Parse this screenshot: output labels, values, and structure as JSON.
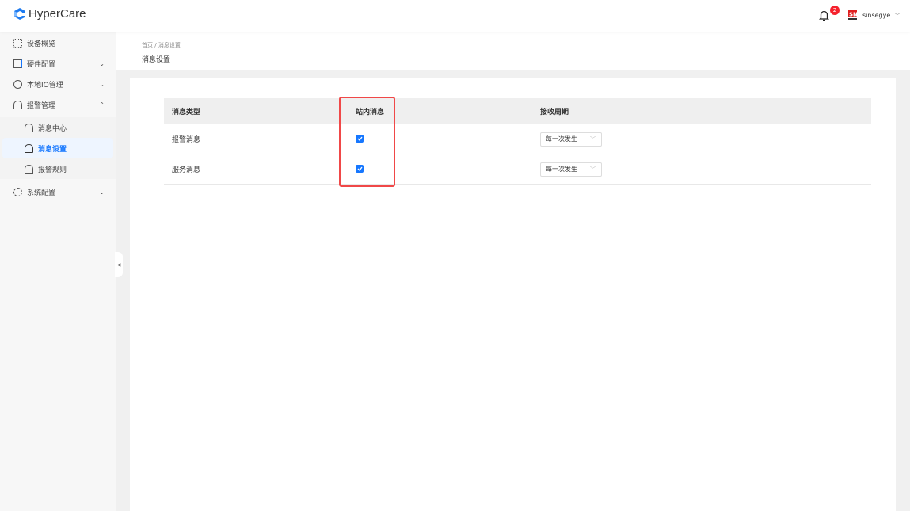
{
  "app": {
    "name": "HyperCare",
    "notification_count": "2",
    "username": "sinsegye"
  },
  "sidebar": {
    "items": [
      {
        "label": "设备概览"
      },
      {
        "label": "硬件配置"
      },
      {
        "label": "本地IO管理"
      },
      {
        "label": "报警管理"
      },
      {
        "label": "消息中心"
      },
      {
        "label": "消息设置"
      },
      {
        "label": "报警规则"
      },
      {
        "label": "系统配置"
      }
    ]
  },
  "breadcrumb": {
    "home": "首页",
    "sep": "/",
    "current": "消息设置"
  },
  "page_title": "消息设置",
  "table": {
    "headers": [
      "消息类型",
      "站内消息",
      "接收周期"
    ],
    "rows": [
      {
        "type": "报警消息",
        "in_site": true,
        "period": "每一次发生"
      },
      {
        "type": "服务消息",
        "in_site": true,
        "period": "每一次发生"
      }
    ]
  },
  "colors": {
    "accent": "#1677ff",
    "highlight": "#f04848"
  }
}
